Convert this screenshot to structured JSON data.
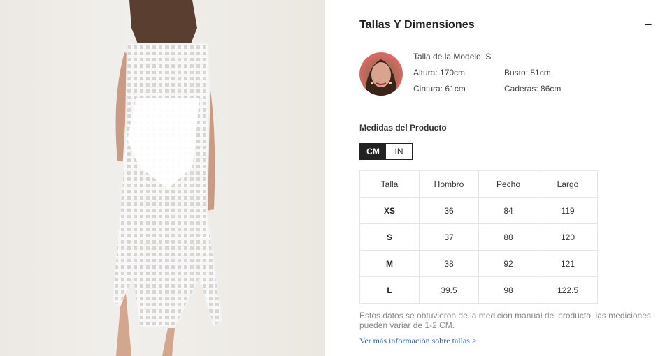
{
  "product_image": {
    "alt_icon": "product-photo"
  },
  "size_section": {
    "title": "Tallas Y Dimensiones",
    "collapse_symbol": "−"
  },
  "model": {
    "size_label": "Talla de la Modelo: S",
    "height": "Altura: 170cm",
    "bust": "Busto: 81cm",
    "waist": "Cintura: 61cm",
    "hips": "Caderas: 86cm"
  },
  "measurements": {
    "heading": "Medidas del Producto",
    "units": [
      {
        "label": "CM",
        "active": true
      },
      {
        "label": "IN",
        "active": false
      }
    ],
    "headers": [
      "Talla",
      "Hombro",
      "Pecho",
      "Largo"
    ],
    "rows": [
      [
        "XS",
        "36",
        "84",
        "119"
      ],
      [
        "S",
        "37",
        "88",
        "120"
      ],
      [
        "M",
        "38",
        "92",
        "121"
      ],
      [
        "L",
        "39.5",
        "98",
        "122.5"
      ]
    ]
  },
  "note": "Estos datos se obtuvieron de la medición manual del producto, las mediciones pueden variar de 1-2 CM.",
  "more_link": "Ver más información sobre tallas >",
  "colors": {
    "accent_link": "#2f5fa6",
    "toggle_active": "#222222"
  }
}
